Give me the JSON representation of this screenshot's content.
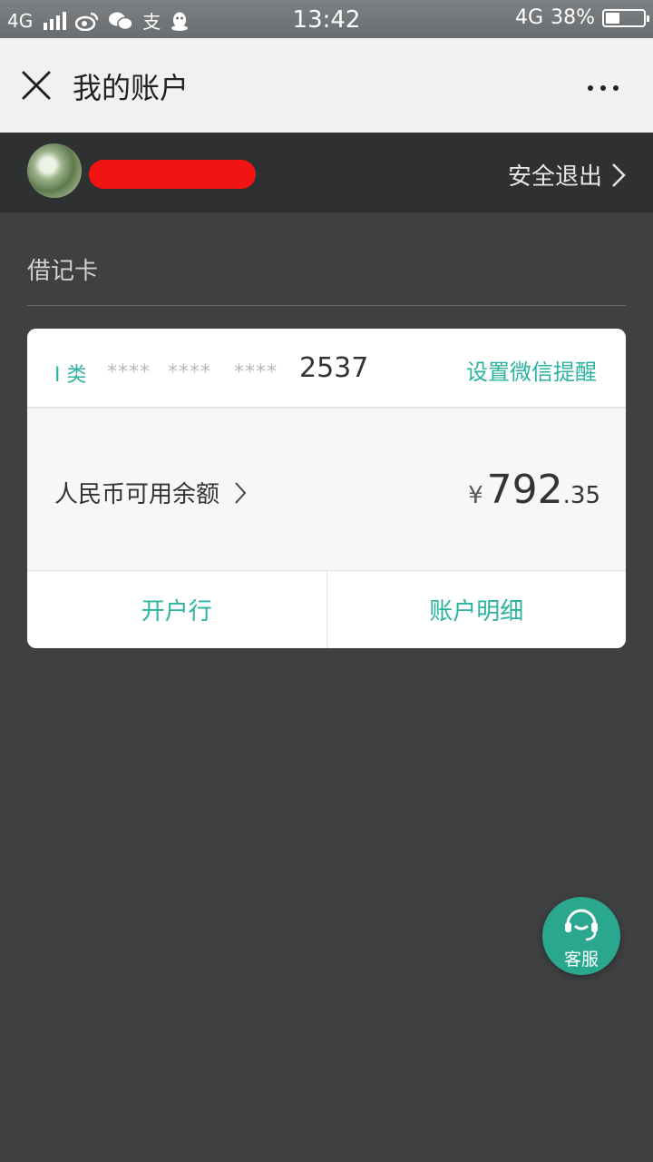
{
  "status_bar": {
    "network_left": "4G",
    "app_icons": [
      "weibo-icon",
      "wechat-icon",
      "alipay-icon",
      "qq-icon"
    ],
    "alipay_glyph": "支",
    "time": "13:42",
    "network_right": "4G",
    "battery_text": "38%",
    "battery_level": 0.38
  },
  "title_bar": {
    "title": "我的账户",
    "close_icon": "close-icon",
    "more_icon": "more-icon"
  },
  "user_row": {
    "logout_label": "安全退出"
  },
  "account_section": {
    "label": "借记卡"
  },
  "card": {
    "type_label": "I 类",
    "masked_groups": [
      "****",
      "****",
      "****"
    ],
    "last4": "2537",
    "remind_label": "设置微信提醒",
    "balance_label": "人民币可用余额",
    "currency_symbol": "¥",
    "amount_int": "792",
    "amount_dec": ".35",
    "actions": [
      "开户行",
      "账户明细"
    ]
  },
  "service_button": {
    "label": "客服"
  },
  "colors": {
    "accent": "#2bb3a0",
    "service_bg": "#2aa88f",
    "page_bg": "#3f4041",
    "redaction": "#f21313"
  }
}
